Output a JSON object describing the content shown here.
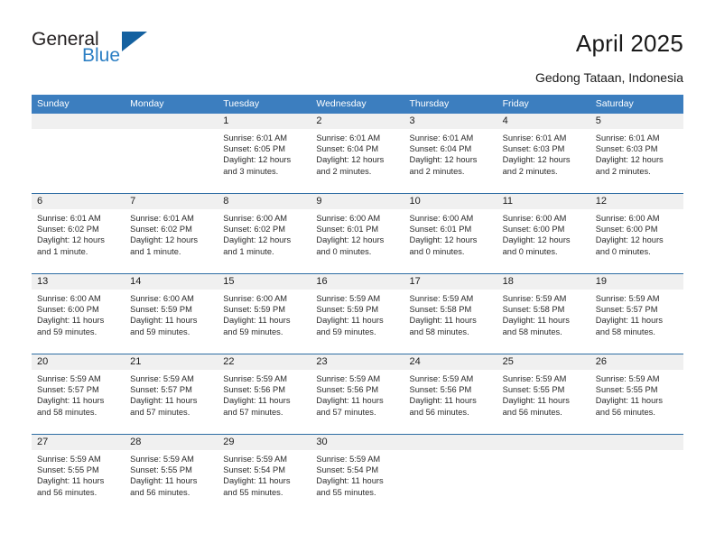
{
  "brand": {
    "name_part1": "General",
    "name_part2": "Blue",
    "triangle_color": "#1461a0",
    "blue_color": "#2c7fc4"
  },
  "header": {
    "title": "April 2025",
    "subtitle": "Gedong Tataan, Indonesia"
  },
  "theme": {
    "header_bg": "#3c7ebf",
    "header_text": "#ffffff",
    "week_divider": "#2e6da4",
    "daynum_band": "#f0f0f0"
  },
  "calendar": {
    "weekday_headers": [
      "Sunday",
      "Monday",
      "Tuesday",
      "Wednesday",
      "Thursday",
      "Friday",
      "Saturday"
    ],
    "weeks": [
      [
        {
          "day": "",
          "sunrise": "",
          "sunset": "",
          "daylight": ""
        },
        {
          "day": "",
          "sunrise": "",
          "sunset": "",
          "daylight": ""
        },
        {
          "day": "1",
          "sunrise": "Sunrise: 6:01 AM",
          "sunset": "Sunset: 6:05 PM",
          "daylight": "Daylight: 12 hours and 3 minutes."
        },
        {
          "day": "2",
          "sunrise": "Sunrise: 6:01 AM",
          "sunset": "Sunset: 6:04 PM",
          "daylight": "Daylight: 12 hours and 2 minutes."
        },
        {
          "day": "3",
          "sunrise": "Sunrise: 6:01 AM",
          "sunset": "Sunset: 6:04 PM",
          "daylight": "Daylight: 12 hours and 2 minutes."
        },
        {
          "day": "4",
          "sunrise": "Sunrise: 6:01 AM",
          "sunset": "Sunset: 6:03 PM",
          "daylight": "Daylight: 12 hours and 2 minutes."
        },
        {
          "day": "5",
          "sunrise": "Sunrise: 6:01 AM",
          "sunset": "Sunset: 6:03 PM",
          "daylight": "Daylight: 12 hours and 2 minutes."
        }
      ],
      [
        {
          "day": "6",
          "sunrise": "Sunrise: 6:01 AM",
          "sunset": "Sunset: 6:02 PM",
          "daylight": "Daylight: 12 hours and 1 minute."
        },
        {
          "day": "7",
          "sunrise": "Sunrise: 6:01 AM",
          "sunset": "Sunset: 6:02 PM",
          "daylight": "Daylight: 12 hours and 1 minute."
        },
        {
          "day": "8",
          "sunrise": "Sunrise: 6:00 AM",
          "sunset": "Sunset: 6:02 PM",
          "daylight": "Daylight: 12 hours and 1 minute."
        },
        {
          "day": "9",
          "sunrise": "Sunrise: 6:00 AM",
          "sunset": "Sunset: 6:01 PM",
          "daylight": "Daylight: 12 hours and 0 minutes."
        },
        {
          "day": "10",
          "sunrise": "Sunrise: 6:00 AM",
          "sunset": "Sunset: 6:01 PM",
          "daylight": "Daylight: 12 hours and 0 minutes."
        },
        {
          "day": "11",
          "sunrise": "Sunrise: 6:00 AM",
          "sunset": "Sunset: 6:00 PM",
          "daylight": "Daylight: 12 hours and 0 minutes."
        },
        {
          "day": "12",
          "sunrise": "Sunrise: 6:00 AM",
          "sunset": "Sunset: 6:00 PM",
          "daylight": "Daylight: 12 hours and 0 minutes."
        }
      ],
      [
        {
          "day": "13",
          "sunrise": "Sunrise: 6:00 AM",
          "sunset": "Sunset: 6:00 PM",
          "daylight": "Daylight: 11 hours and 59 minutes."
        },
        {
          "day": "14",
          "sunrise": "Sunrise: 6:00 AM",
          "sunset": "Sunset: 5:59 PM",
          "daylight": "Daylight: 11 hours and 59 minutes."
        },
        {
          "day": "15",
          "sunrise": "Sunrise: 6:00 AM",
          "sunset": "Sunset: 5:59 PM",
          "daylight": "Daylight: 11 hours and 59 minutes."
        },
        {
          "day": "16",
          "sunrise": "Sunrise: 5:59 AM",
          "sunset": "Sunset: 5:59 PM",
          "daylight": "Daylight: 11 hours and 59 minutes."
        },
        {
          "day": "17",
          "sunrise": "Sunrise: 5:59 AM",
          "sunset": "Sunset: 5:58 PM",
          "daylight": "Daylight: 11 hours and 58 minutes."
        },
        {
          "day": "18",
          "sunrise": "Sunrise: 5:59 AM",
          "sunset": "Sunset: 5:58 PM",
          "daylight": "Daylight: 11 hours and 58 minutes."
        },
        {
          "day": "19",
          "sunrise": "Sunrise: 5:59 AM",
          "sunset": "Sunset: 5:57 PM",
          "daylight": "Daylight: 11 hours and 58 minutes."
        }
      ],
      [
        {
          "day": "20",
          "sunrise": "Sunrise: 5:59 AM",
          "sunset": "Sunset: 5:57 PM",
          "daylight": "Daylight: 11 hours and 58 minutes."
        },
        {
          "day": "21",
          "sunrise": "Sunrise: 5:59 AM",
          "sunset": "Sunset: 5:57 PM",
          "daylight": "Daylight: 11 hours and 57 minutes."
        },
        {
          "day": "22",
          "sunrise": "Sunrise: 5:59 AM",
          "sunset": "Sunset: 5:56 PM",
          "daylight": "Daylight: 11 hours and 57 minutes."
        },
        {
          "day": "23",
          "sunrise": "Sunrise: 5:59 AM",
          "sunset": "Sunset: 5:56 PM",
          "daylight": "Daylight: 11 hours and 57 minutes."
        },
        {
          "day": "24",
          "sunrise": "Sunrise: 5:59 AM",
          "sunset": "Sunset: 5:56 PM",
          "daylight": "Daylight: 11 hours and 56 minutes."
        },
        {
          "day": "25",
          "sunrise": "Sunrise: 5:59 AM",
          "sunset": "Sunset: 5:55 PM",
          "daylight": "Daylight: 11 hours and 56 minutes."
        },
        {
          "day": "26",
          "sunrise": "Sunrise: 5:59 AM",
          "sunset": "Sunset: 5:55 PM",
          "daylight": "Daylight: 11 hours and 56 minutes."
        }
      ],
      [
        {
          "day": "27",
          "sunrise": "Sunrise: 5:59 AM",
          "sunset": "Sunset: 5:55 PM",
          "daylight": "Daylight: 11 hours and 56 minutes."
        },
        {
          "day": "28",
          "sunrise": "Sunrise: 5:59 AM",
          "sunset": "Sunset: 5:55 PM",
          "daylight": "Daylight: 11 hours and 56 minutes."
        },
        {
          "day": "29",
          "sunrise": "Sunrise: 5:59 AM",
          "sunset": "Sunset: 5:54 PM",
          "daylight": "Daylight: 11 hours and 55 minutes."
        },
        {
          "day": "30",
          "sunrise": "Sunrise: 5:59 AM",
          "sunset": "Sunset: 5:54 PM",
          "daylight": "Daylight: 11 hours and 55 minutes."
        },
        {
          "day": "",
          "sunrise": "",
          "sunset": "",
          "daylight": ""
        },
        {
          "day": "",
          "sunrise": "",
          "sunset": "",
          "daylight": ""
        },
        {
          "day": "",
          "sunrise": "",
          "sunset": "",
          "daylight": ""
        }
      ]
    ]
  }
}
